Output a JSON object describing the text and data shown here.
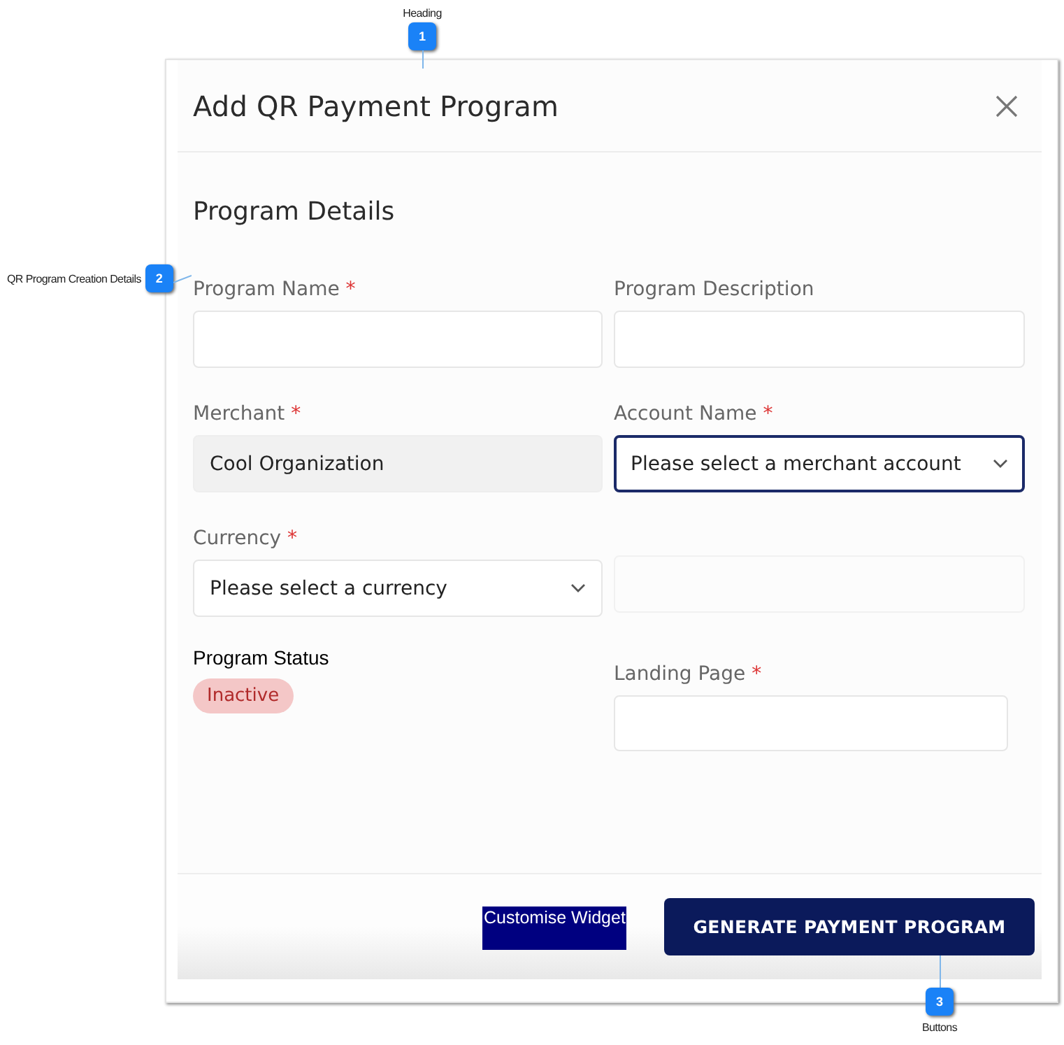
{
  "callouts": [
    {
      "number": "1",
      "label": "Heading",
      "kind": "top"
    },
    {
      "number": "2",
      "label": "QR Program Creation Details",
      "kind": "left"
    },
    {
      "number": "3",
      "label": "Buttons",
      "kind": "bottom"
    }
  ],
  "dialog": {
    "title": "Add QR Payment Program",
    "section_title": "Program Details",
    "fields": [
      {
        "label": "Program Name",
        "required_mark": "*",
        "kind": "text"
      },
      {
        "label": "Program Description",
        "kind": "text"
      },
      {
        "label": "Merchant",
        "required_mark": "*",
        "kind": "readonly",
        "value": "Cool Organization"
      },
      {
        "label": "Account Name",
        "required_mark": "*",
        "kind": "select",
        "value": "Please select a merchant account",
        "focused": true
      },
      {
        "label": "Currency",
        "required_mark": "*",
        "kind": "select",
        "value": "Please select a currency",
        "focused": false
      },
      {
        "kind": "blank"
      }
    ],
    "status": {
      "label": "Program Status",
      "badge": "Inactive"
    },
    "landing_page": {
      "label": "Landing Page",
      "required_mark": "*"
    },
    "buttons": [
      {
        "label": "Customise Widget",
        "kind": "plain"
      },
      {
        "label": "GENERATE PAYMENT PROGRAM",
        "kind": "primary"
      }
    ]
  }
}
